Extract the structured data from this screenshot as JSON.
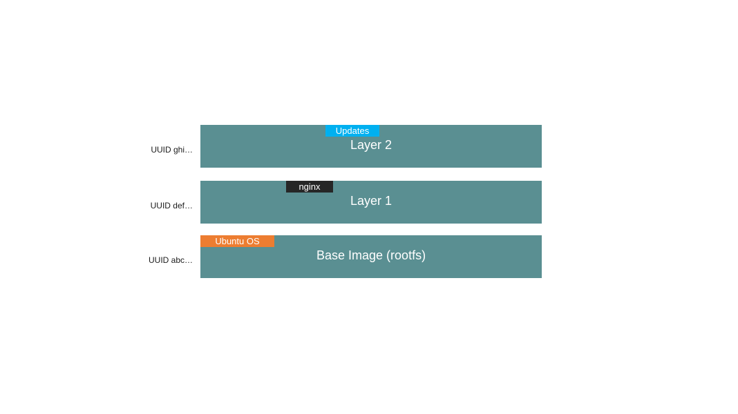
{
  "layers": [
    {
      "uuid": "UUID ghi…",
      "title": "Layer 2",
      "tag_label": "Updates",
      "tag_color": "blue"
    },
    {
      "uuid": "UUID def…",
      "title": "Layer 1",
      "tag_label": "nginx",
      "tag_color": "black"
    },
    {
      "uuid": "UUID abc…",
      "title": "Base Image   (rootfs)",
      "tag_label": "Ubuntu OS",
      "tag_color": "orange"
    }
  ]
}
